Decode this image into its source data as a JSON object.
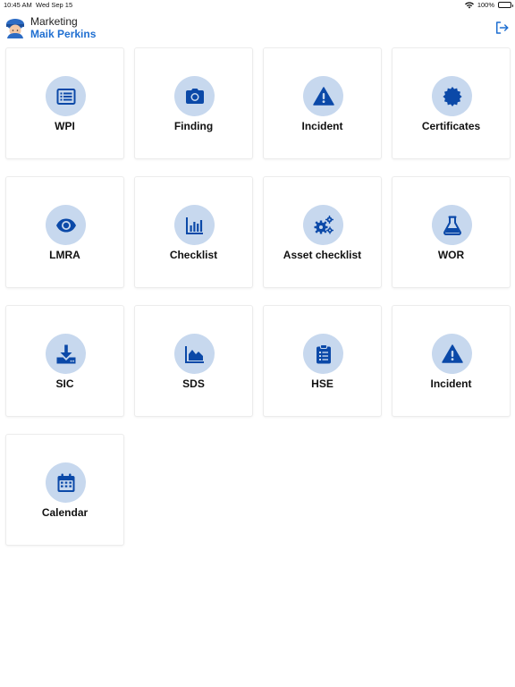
{
  "status_bar": {
    "time": "10:45 AM",
    "date": "Wed Sep 15",
    "battery": "100%"
  },
  "header": {
    "organization": "Marketing",
    "user_name": "Maik Perkins"
  },
  "colors": {
    "accent": "#1f6fd1",
    "icon": "#0b49a8",
    "icon_bg": "#c7d8ee"
  },
  "tiles": [
    {
      "label": "WPI",
      "icon": "list-icon"
    },
    {
      "label": "Finding",
      "icon": "camera-icon"
    },
    {
      "label": "Incident",
      "icon": "warning-icon"
    },
    {
      "label": "Certificates",
      "icon": "certificate-icon"
    },
    {
      "label": "LMRA",
      "icon": "eye-icon"
    },
    {
      "label": "Checklist",
      "icon": "bar-chart-icon"
    },
    {
      "label": "Asset checklist",
      "icon": "gears-icon"
    },
    {
      "label": "WOR",
      "icon": "flask-icon"
    },
    {
      "label": "SIC",
      "icon": "download-icon"
    },
    {
      "label": "SDS",
      "icon": "area-chart-icon"
    },
    {
      "label": "HSE",
      "icon": "clipboard-icon"
    },
    {
      "label": "Incident",
      "icon": "warning-icon"
    },
    {
      "label": "Calendar",
      "icon": "calendar-icon"
    }
  ]
}
